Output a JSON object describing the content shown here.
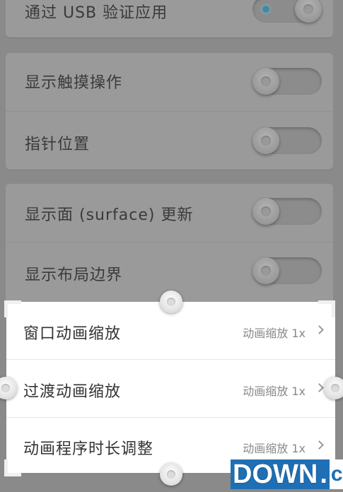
{
  "settings": {
    "card1": {
      "rows": [
        {
          "label": "通过 USB 验证应用",
          "toggle": "on"
        }
      ]
    },
    "card2": {
      "rows": [
        {
          "label": "显示触摸操作",
          "toggle": "off"
        },
        {
          "label": "指针位置",
          "toggle": "off"
        }
      ]
    },
    "card3": {
      "rows": [
        {
          "label": "显示面 (surface) 更新",
          "toggle": "off"
        },
        {
          "label": "显示布局边界",
          "toggle": "off"
        }
      ]
    }
  },
  "selection_panel": {
    "rows": [
      {
        "label": "窗口动画缩放",
        "value": "动画缩放 1x"
      },
      {
        "label": "过渡动画缩放",
        "value": "动画缩放 1x"
      },
      {
        "label": "动画程序时长调整",
        "value": "动画缩放 1x"
      }
    ]
  },
  "watermark": {
    "part1": "DOWN",
    "part2": ".",
    "part3": "cc"
  },
  "colors": {
    "overlay_gray": "#8a8a8a",
    "card_gray": "#9a9a9a",
    "toggle_on_dot": "#3f8aa3",
    "watermark_blue": "#1f6fb5"
  }
}
